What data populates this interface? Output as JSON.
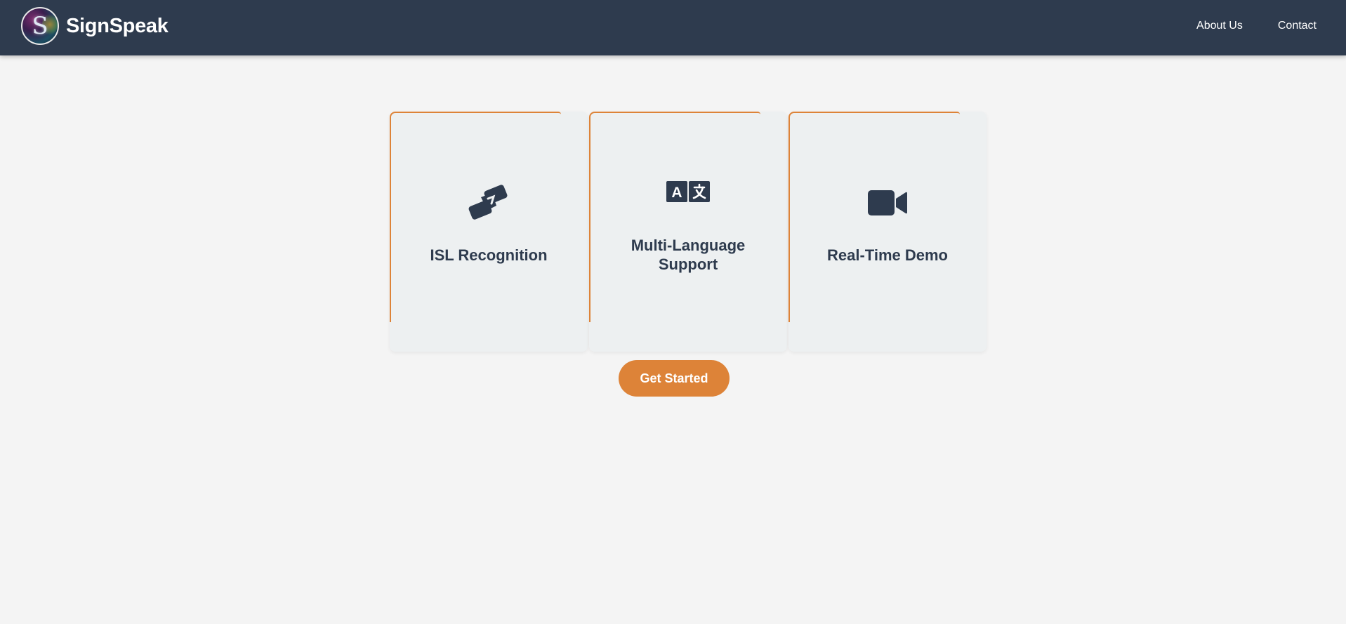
{
  "brand": {
    "name": "SignSpeak",
    "logo_letter": "S"
  },
  "nav": {
    "links": [
      "About Us",
      "Contact"
    ]
  },
  "cards": [
    {
      "icon": "handshake-icon",
      "title": "ISL Recognition"
    },
    {
      "icon": "language-icon",
      "title": "Multi-Language Support"
    },
    {
      "icon": "video-camera-icon",
      "title": "Real-Time Demo"
    }
  ],
  "cta": {
    "label": "Get Started"
  },
  "colors": {
    "navbar": "#2e3b4e",
    "accent": "#dd8338",
    "background": "#f4f4f4",
    "card": "#edf0f1",
    "text": "#2e3b4e"
  }
}
